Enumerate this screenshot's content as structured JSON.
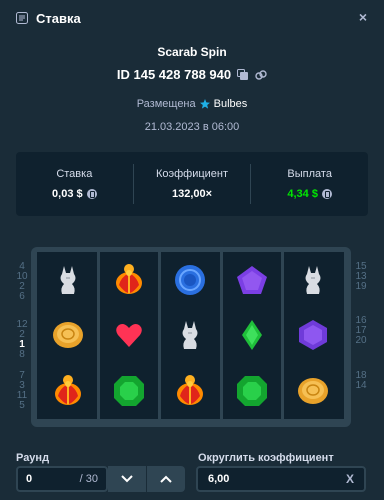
{
  "header": {
    "title": "Ставка",
    "close_label": "×"
  },
  "game": {
    "title": "Scarab Spin",
    "id": "ID 145 428 788 940",
    "placed_label": "Размещена",
    "user": "Bulbes",
    "date": "21.03.2023 в 06:00"
  },
  "stats": [
    {
      "label": "Ставка",
      "value": "0,03 $"
    },
    {
      "label": "Коэффициент",
      "value": "132,00×"
    },
    {
      "label": "Выплата",
      "value": "4,34 $"
    }
  ],
  "reels": {
    "rows": [
      [
        "jackal",
        "scarab",
        "blue-ring",
        "purple-pentagon",
        "jackal"
      ],
      [
        "gold-coin",
        "red-heart",
        "jackal",
        "green-diamond",
        "purple-hexagon"
      ],
      [
        "scarab",
        "green-octagon",
        "scarab",
        "green-octagon",
        "gold-coin"
      ]
    ]
  },
  "paylines": {
    "left_top": [
      "4",
      "10",
      "2",
      "6"
    ],
    "left_mid": [
      "12",
      "2",
      "1",
      "8"
    ],
    "left_bot": [
      "7",
      "3",
      "11",
      "5"
    ],
    "right_top": [
      "15",
      "13",
      "19"
    ],
    "right_mid": [
      "16",
      "17",
      "20"
    ],
    "right_bot": [
      "18",
      "14"
    ],
    "active": "1"
  },
  "controls": {
    "round_label": "Раунд",
    "round_value": "0",
    "round_total": "/ 30",
    "round_coef_label": "Округлить коэффициент",
    "round_coef_value": "6,00",
    "clear_label": "X"
  },
  "colors": {
    "bg": "#1a2c38",
    "panel": "#0f212e",
    "accent_green": "#00e701"
  }
}
